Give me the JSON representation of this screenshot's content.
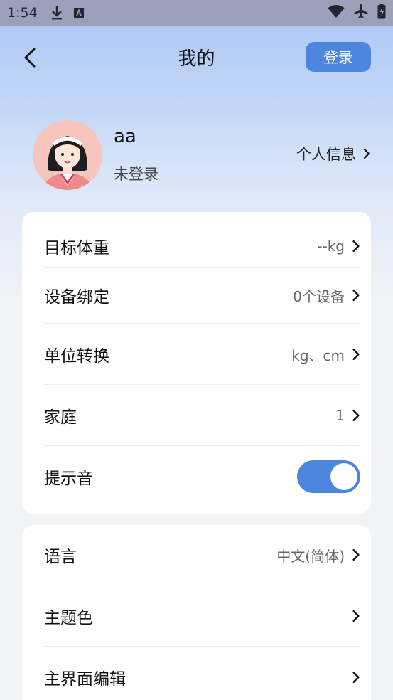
{
  "status_bar": {
    "time": "1:54",
    "icons_left": [
      "download-icon",
      "font-a-icon"
    ],
    "icons_right": [
      "wifi-icon",
      "airplane-icon",
      "battery-icon"
    ]
  },
  "header": {
    "title": "我的",
    "login_label": "登录",
    "back_icon": "chevron-left-icon"
  },
  "profile": {
    "username": "aa",
    "status": "未登录",
    "link_label": "个人信息"
  },
  "card1": {
    "items": [
      {
        "label": "目标体重",
        "value": "--kg"
      },
      {
        "label": "设备绑定",
        "value": "0个设备"
      },
      {
        "label": "单位转换",
        "value": "kg、cm"
      },
      {
        "label": "家庭",
        "value": "1"
      },
      {
        "label": "提示音",
        "toggle": true
      }
    ]
  },
  "card2": {
    "items": [
      {
        "label": "语言",
        "value": "中文(简体)"
      },
      {
        "label": "主题色",
        "value": ""
      },
      {
        "label": "主界面编辑",
        "value": ""
      }
    ]
  },
  "colors": {
    "accent": "#4d86de",
    "status_bar": "#9aa1b9",
    "background": "#f2f3f5"
  }
}
